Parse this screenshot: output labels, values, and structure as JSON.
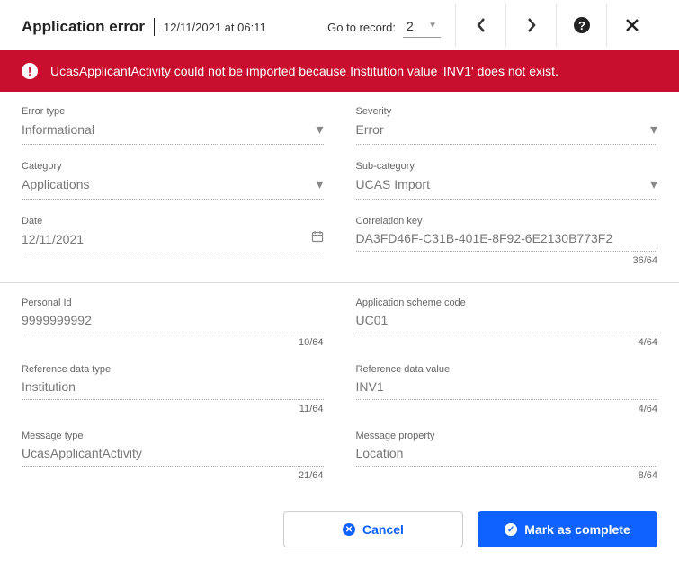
{
  "header": {
    "title": "Application error",
    "timestamp": "12/11/2021 at 06:11",
    "goto_label": "Go to record:",
    "goto_value": "2"
  },
  "banner": {
    "message": "UcasApplicantActivity could not be imported because Institution value 'INV1' does not exist."
  },
  "fields": {
    "error_type": {
      "label": "Error type",
      "value": "Informational"
    },
    "severity": {
      "label": "Severity",
      "value": "Error"
    },
    "category": {
      "label": "Category",
      "value": "Applications"
    },
    "sub_category": {
      "label": "Sub-category",
      "value": "UCAS Import"
    },
    "date": {
      "label": "Date",
      "value": "12/11/2021"
    },
    "correlation_key": {
      "label": "Correlation key",
      "value": "DA3FD46F-C31B-401E-8F92-6E2130B773F2",
      "counter": "36/64"
    },
    "personal_id": {
      "label": "Personal Id",
      "value": "9999999992",
      "counter": "10/64"
    },
    "application_scheme_code": {
      "label": "Application scheme code",
      "value": "UC01",
      "counter": "4/64"
    },
    "reference_data_type": {
      "label": "Reference data type",
      "value": "Institution",
      "counter": "11/64"
    },
    "reference_data_value": {
      "label": "Reference data value",
      "value": "INV1",
      "counter": "4/64"
    },
    "message_type": {
      "label": "Message type",
      "value": "UcasApplicantActivity",
      "counter": "21/64"
    },
    "message_property": {
      "label": "Message property",
      "value": "Location",
      "counter": "8/64"
    }
  },
  "footer": {
    "cancel": "Cancel",
    "mark_complete": "Mark as complete"
  }
}
